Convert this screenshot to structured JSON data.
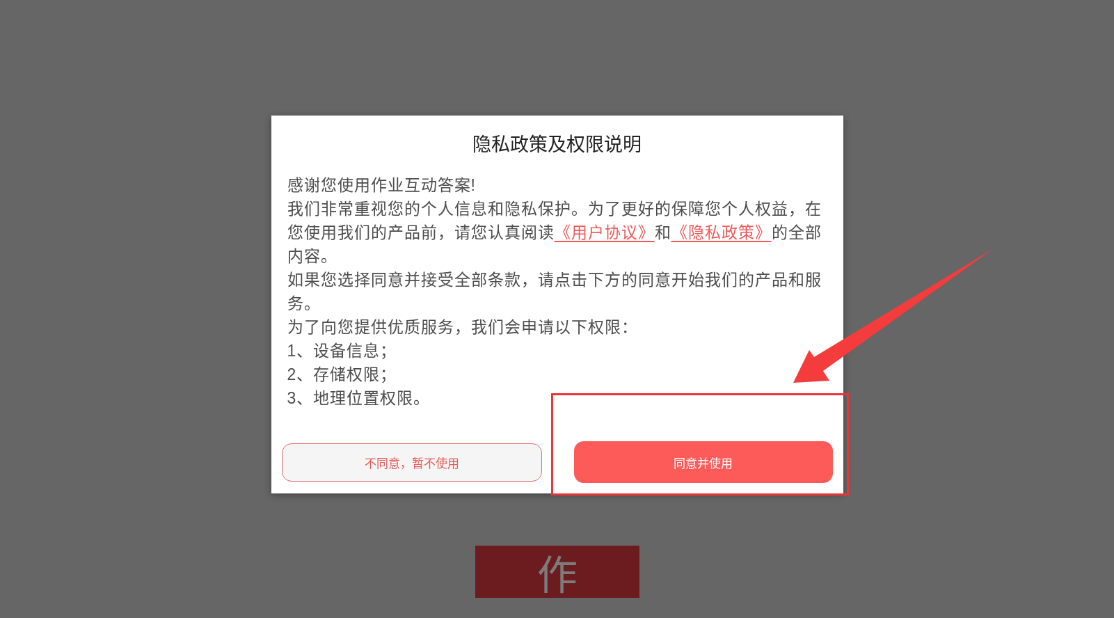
{
  "dialog": {
    "title": "隐私政策及权限说明",
    "paragraphs": [
      {
        "segments": [
          {
            "kind": "text",
            "text": "感谢您使用作业互动答案!"
          }
        ]
      },
      {
        "segments": [
          {
            "kind": "text",
            "text": "我们非常重视您的个人信息和隐私保护。为了更好的保障您个人权益，在您使用我们的产品前，请您认真阅读"
          },
          {
            "kind": "link",
            "text": "《用户协议》"
          },
          {
            "kind": "text",
            "text": "和"
          },
          {
            "kind": "link",
            "text": "《隐私政策》"
          },
          {
            "kind": "text",
            "text": "的全部内容。"
          }
        ]
      },
      {
        "segments": [
          {
            "kind": "text",
            "text": "如果您选择同意并接受全部条款，请点击下方的同意开始我们的产品和服务。"
          }
        ]
      },
      {
        "segments": [
          {
            "kind": "text",
            "text": "为了向您提供优质服务，我们会申请以下权限："
          }
        ]
      },
      {
        "segments": [
          {
            "kind": "text",
            "text": "1、设备信息；"
          }
        ]
      },
      {
        "segments": [
          {
            "kind": "text",
            "text": "2、存储权限；"
          }
        ]
      },
      {
        "segments": [
          {
            "kind": "text",
            "text": "3、地理位置权限。"
          }
        ]
      }
    ],
    "buttons": [
      {
        "kind": "secondary",
        "label": "不同意，暂不使用"
      },
      {
        "kind": "primary",
        "label": "同意并使用"
      }
    ]
  },
  "background_logo": {
    "text": "作"
  }
}
